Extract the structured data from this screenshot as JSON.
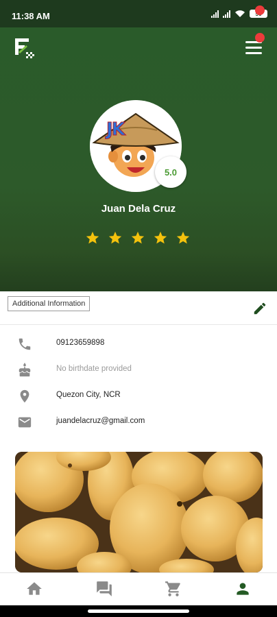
{
  "status_bar": {
    "time": "11:38 AM",
    "battery": "56"
  },
  "header": {
    "logo_icon": "app-logo-icon",
    "menu_icon": "hamburger-menu-icon",
    "has_notification": true
  },
  "profile": {
    "name": "Juan Dela Cruz",
    "rating": "5.0",
    "stars": 5,
    "avatar_icon": "farmer-avatar-icon",
    "avatar_badge_text": "JK"
  },
  "info_section": {
    "label": "Additional Information",
    "edit_icon": "pencil-edit-icon",
    "rows": [
      {
        "icon": "phone-icon",
        "text": "09123659898",
        "muted": false
      },
      {
        "icon": "cake-icon",
        "text": "No birthdate provided",
        "muted": true
      },
      {
        "icon": "location-pin-icon",
        "text": "Quezon City, NCR",
        "muted": false
      },
      {
        "icon": "mail-icon",
        "text": "juandelacruz@gmail.com",
        "muted": false
      }
    ]
  },
  "banner_image": {
    "subject": "mangoes-photo"
  },
  "bottom_nav": {
    "items": [
      {
        "icon": "home-icon",
        "active": false
      },
      {
        "icon": "chat-icon",
        "active": false
      },
      {
        "icon": "cart-icon",
        "active": false
      },
      {
        "icon": "profile-icon",
        "active": true
      }
    ]
  },
  "colors": {
    "brand_green": "#2a5b2a",
    "star": "#f4c20d",
    "rating_text": "#4a9a33",
    "active_nav": "#245a24",
    "inactive_nav": "#8a8a8a",
    "notification": "#ec3b3b"
  }
}
